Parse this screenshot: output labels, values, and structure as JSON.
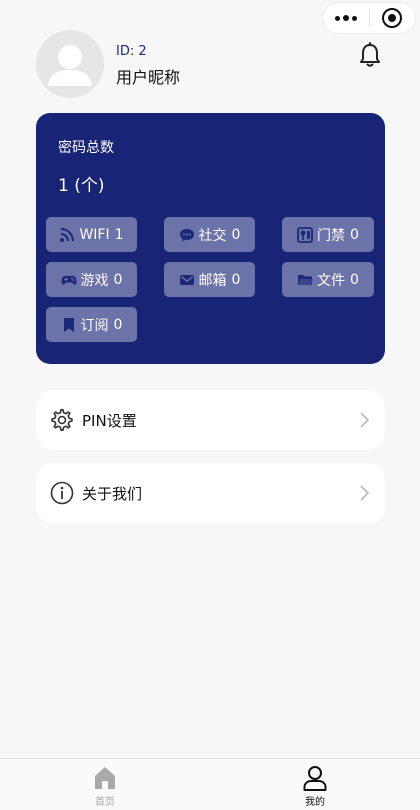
{
  "profile": {
    "id_text": "ID: 2",
    "nickname": "用户昵称"
  },
  "stats": {
    "title": "密码总数",
    "count_text": "1 (个)",
    "categories": [
      {
        "label": "WIFI",
        "count": "1",
        "icon": "wifi-icon"
      },
      {
        "label": "社交",
        "count": "0",
        "icon": "chat-icon"
      },
      {
        "label": "门禁",
        "count": "0",
        "icon": "access-card-icon"
      },
      {
        "label": "游戏",
        "count": "0",
        "icon": "gamepad-icon"
      },
      {
        "label": "邮箱",
        "count": "0",
        "icon": "mail-icon"
      },
      {
        "label": "文件",
        "count": "0",
        "icon": "folder-icon"
      },
      {
        "label": "订阅",
        "count": "0",
        "icon": "bookmark-icon"
      }
    ]
  },
  "menu": {
    "pin_settings": "PIN设置",
    "about_us": "关于我们"
  },
  "tabbar": {
    "home": "首页",
    "mine": "我的"
  },
  "colors": {
    "card_bg": "#182476",
    "tag_bg": "#6c73a8",
    "page_bg": "#f7f7f7"
  }
}
